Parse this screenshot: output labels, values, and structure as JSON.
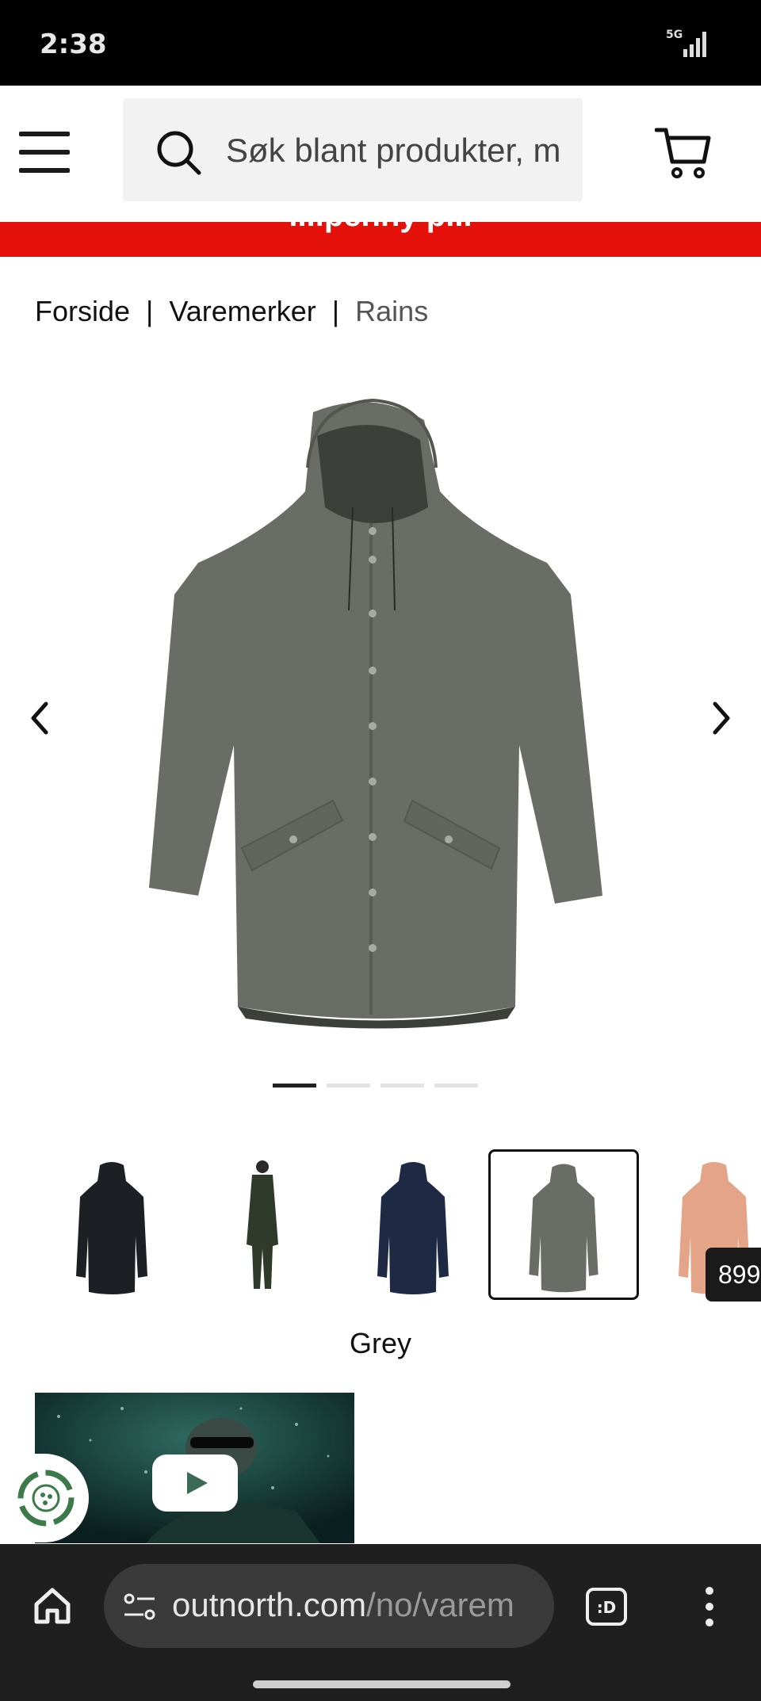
{
  "status_bar": {
    "time": "2:38",
    "network": "5G"
  },
  "header": {
    "search_placeholder": "Søk blant produkter, m"
  },
  "promo_banner": {
    "text": "...lpenny p..."
  },
  "breadcrumb": {
    "items": [
      "Forside",
      "Varemerker",
      "Rains"
    ],
    "separator": "|"
  },
  "carousel": {
    "total_slides": 4,
    "active_slide": 1
  },
  "thumbnails": {
    "colors": [
      "#1c1f24",
      "#2f3a2a",
      "#1e2a44",
      "#6a6c66",
      "#e3a488"
    ],
    "selected_index": 3,
    "price_badge": "899"
  },
  "color_label": "Grey",
  "browser": {
    "url_domain": "outnorth.com",
    "url_path": "/no/varem"
  },
  "colors": {
    "promo_red": "#e31109",
    "product_grey": "#6a6c66"
  }
}
